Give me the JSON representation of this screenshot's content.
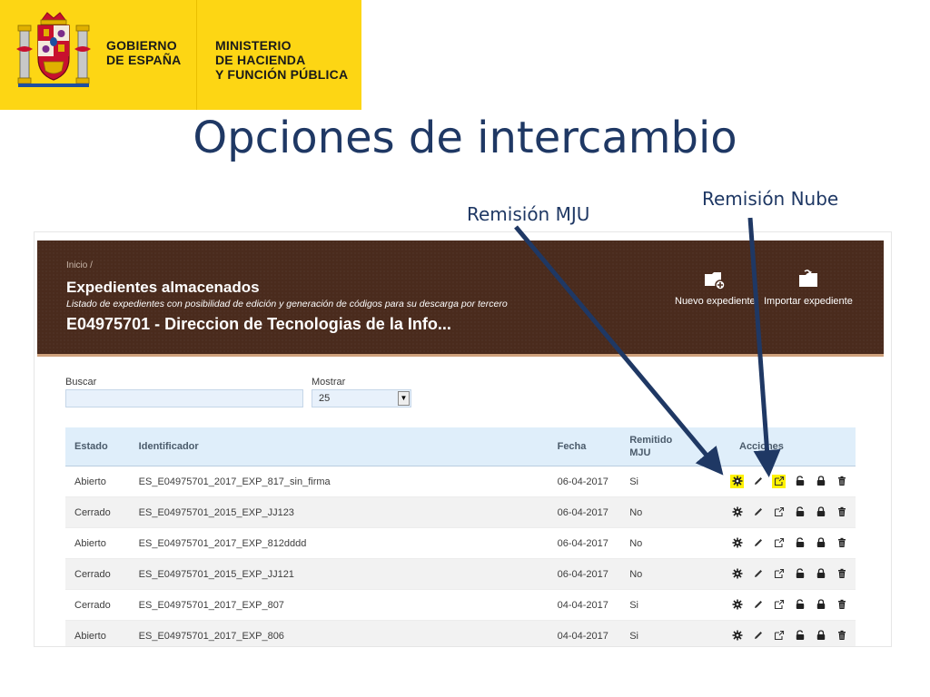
{
  "gov": {
    "line1": "GOBIERNO",
    "line2": "DE ESPAÑA",
    "min1": "MINISTERIO",
    "min2": "DE HACIENDA",
    "min3": "Y FUNCIÓN PÚBLICA"
  },
  "slide_title": "Opciones de intercambio",
  "callouts": {
    "mju": "Remisión MJU",
    "nube": "Remisión Nube"
  },
  "app": {
    "breadcrumb": "Inicio /",
    "title": "Expedientes almacenados",
    "subtitle": "Listado de expedientes con posibilidad de edición y generación de códigos para su descarga por tercero",
    "entity": "E04975701 - Direccion de Tecnologias de la Info...",
    "buttons": {
      "nuevo": "Nuevo expediente",
      "importar": "Importar expediente"
    },
    "search_label": "Buscar",
    "search_value": "",
    "show_label": "Mostrar",
    "show_value": "25",
    "columns": {
      "estado": "Estado",
      "identificador": "Identificador",
      "fecha": "Fecha",
      "remitido1": "Remitido",
      "remitido2": "MJU",
      "acciones": "Acciones"
    },
    "rows": [
      {
        "estado": "Abierto",
        "id": "ES_E04975701_2017_EXP_817_sin_firma",
        "fecha": "06-04-2017",
        "remitido": "Si"
      },
      {
        "estado": "Cerrado",
        "id": "ES_E04975701_2015_EXP_JJ123",
        "fecha": "06-04-2017",
        "remitido": "No"
      },
      {
        "estado": "Abierto",
        "id": "ES_E04975701_2017_EXP_812dddd",
        "fecha": "06-04-2017",
        "remitido": "No"
      },
      {
        "estado": "Cerrado",
        "id": "ES_E04975701_2015_EXP_JJ121",
        "fecha": "06-04-2017",
        "remitido": "No"
      },
      {
        "estado": "Cerrado",
        "id": "ES_E04975701_2017_EXP_807",
        "fecha": "04-04-2017",
        "remitido": "Si"
      },
      {
        "estado": "Abierto",
        "id": "ES_E04975701_2017_EXP_806",
        "fecha": "04-04-2017",
        "remitido": "Si"
      }
    ],
    "row_actions": [
      "gear-icon",
      "pencil-icon",
      "share-icon",
      "unlock-icon",
      "lock-icon",
      "trash-icon"
    ]
  },
  "colors": {
    "banner": "#fdd614",
    "title": "#1f3864",
    "header_bg": "#4a2b1d",
    "table_header": "#dfeefa",
    "highlight": "#fff200"
  }
}
